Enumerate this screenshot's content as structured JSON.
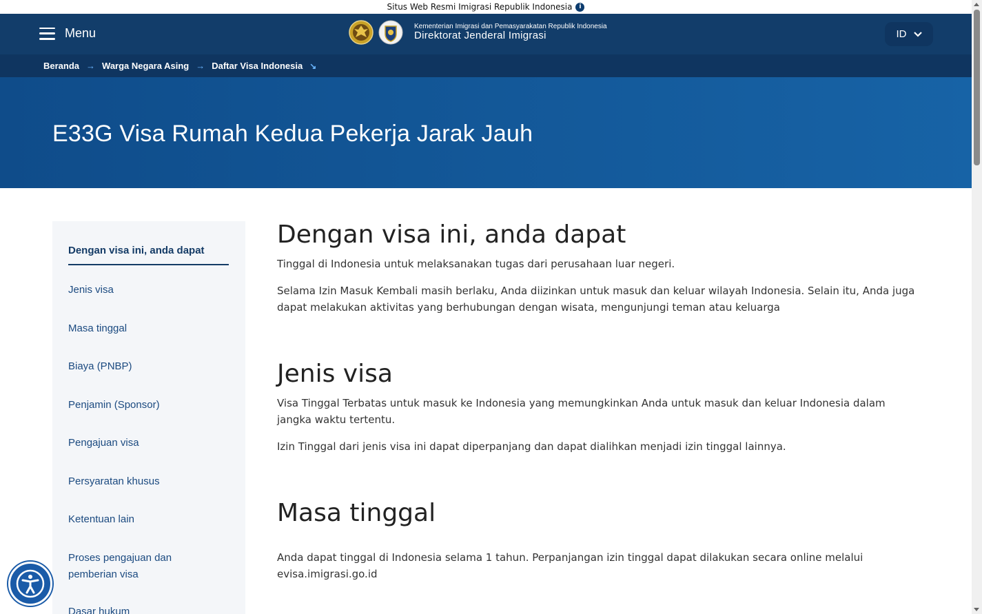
{
  "topbar": {
    "text": "Situs Web Resmi Imigrasi Republik Indonesia"
  },
  "header": {
    "menu_label": "Menu",
    "brand_sub": "Kementerian Imigrasi dan Pemasyarakatan Republik Indonesia",
    "brand_main": "Direktorat Jenderal Imigrasi",
    "language": "ID"
  },
  "breadcrumb": [
    "Beranda",
    "Warga Negara Asing",
    "Daftar Visa Indonesia"
  ],
  "hero": {
    "title": "E33G Visa Rumah Kedua Pekerja Jarak Jauh"
  },
  "sidebar": {
    "items": [
      "Dengan visa ini, anda dapat",
      "Jenis visa",
      "Masa tinggal",
      "Biaya (PNBP)",
      "Penjamin (Sponsor)",
      "Pengajuan visa",
      "Persyaratan khusus",
      "Ketentuan lain",
      "Proses pengajuan dan pemberian visa",
      "Dasar hukum"
    ]
  },
  "sections": [
    {
      "title": "Dengan visa ini, anda dapat",
      "paragraphs": [
        "Tinggal di Indonesia untuk melaksanakan tugas dari perusahaan luar negeri.",
        "Selama Izin Masuk Kembali masih berlaku, Anda diizinkan untuk masuk dan keluar wilayah Indonesia. Selain itu, Anda juga dapat melakukan aktivitas yang berhubungan dengan wisata, mengunjungi teman atau keluarga"
      ]
    },
    {
      "title": "Jenis visa",
      "paragraphs": [
        "Visa Tinggal Terbatas untuk masuk ke Indonesia yang memungkinkan Anda untuk masuk dan keluar Indonesia dalam jangka waktu tertentu.",
        "Izin Tinggal dari jenis visa ini dapat diperpanjang dan dapat dialihkan menjadi izin tinggal lainnya."
      ]
    },
    {
      "title": "Masa tinggal",
      "paragraphs": [
        "Anda dapat tinggal di Indonesia selama 1 tahun. Perpanjangan izin tinggal dapat dilakukan secara online melalui evisa.imigrasi.go.id"
      ]
    }
  ],
  "icons": {
    "info": "info-icon",
    "menu": "hamburger-icon",
    "lang_dropdown": "chevron-down-icon",
    "accessibility": "accessibility-icon"
  },
  "colors": {
    "header_bg": "#123d6a",
    "breadcrumb_bg": "#0f3560",
    "hero_bg": "#1763a6",
    "accent": "#6bb6ff",
    "sidebar_bg": "#f4f6f9"
  }
}
